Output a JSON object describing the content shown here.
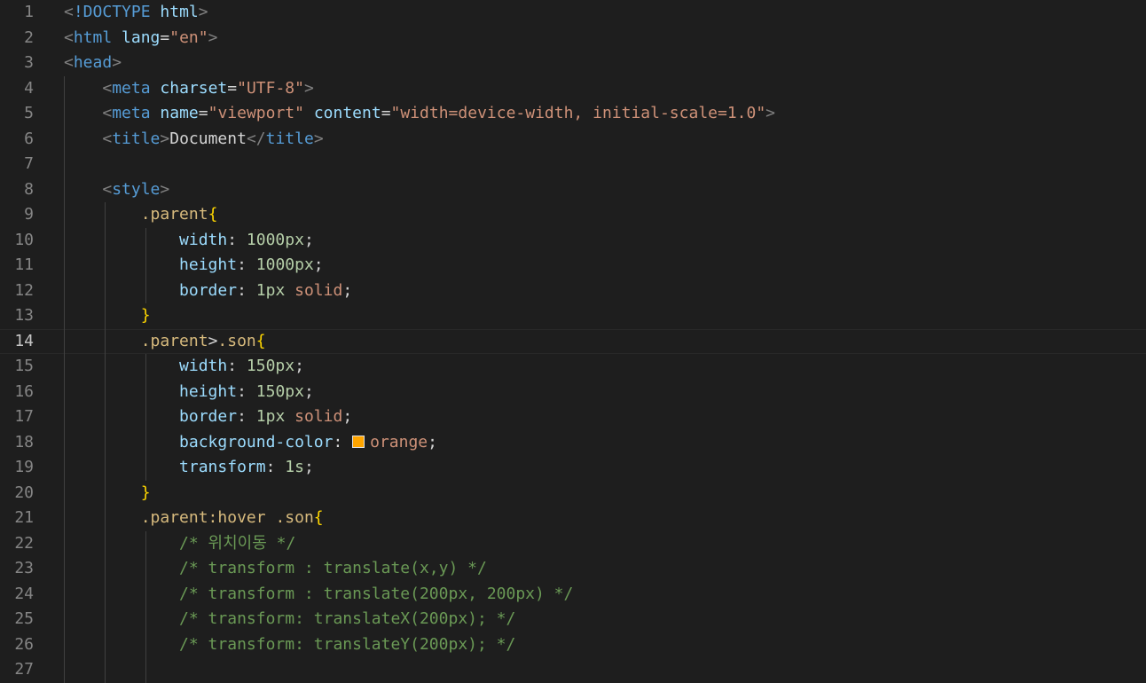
{
  "editor": {
    "current_line": 14,
    "swatch_color": "#ffa500",
    "lines": [
      {
        "n": "1",
        "indent": 0,
        "tokens": [
          [
            "&lt;",
            "p"
          ]
        ]
      },
      {
        "n": "2",
        "indent": 0,
        "tokens": []
      },
      {
        "n": "3",
        "indent": 0,
        "tokens": []
      }
    ]
  },
  "lines": [
    {
      "n": "1",
      "tokens": [
        [
          "<",
          "punct"
        ],
        [
          "!DOCTYPE",
          "tag"
        ],
        [
          " ",
          "text"
        ],
        [
          "html",
          "attr"
        ],
        [
          ">",
          "punct"
        ]
      ]
    },
    {
      "n": "2",
      "tokens": [
        [
          "<",
          "punct"
        ],
        [
          "html",
          "tag"
        ],
        [
          " ",
          "text"
        ],
        [
          "lang",
          "attr"
        ],
        [
          "=",
          "text"
        ],
        [
          "\"en\"",
          "str"
        ],
        [
          ">",
          "punct"
        ]
      ]
    },
    {
      "n": "3",
      "tokens": [
        [
          "<",
          "punct"
        ],
        [
          "head",
          "tag"
        ],
        [
          ">",
          "punct"
        ]
      ]
    },
    {
      "n": "4",
      "tokens": [
        [
          "    ",
          "text"
        ],
        [
          "<",
          "punct"
        ],
        [
          "meta",
          "tag"
        ],
        [
          " ",
          "text"
        ],
        [
          "charset",
          "attr"
        ],
        [
          "=",
          "text"
        ],
        [
          "\"UTF-8\"",
          "str"
        ],
        [
          ">",
          "punct"
        ]
      ]
    },
    {
      "n": "5",
      "tokens": [
        [
          "    ",
          "text"
        ],
        [
          "<",
          "punct"
        ],
        [
          "meta",
          "tag"
        ],
        [
          " ",
          "text"
        ],
        [
          "name",
          "attr"
        ],
        [
          "=",
          "text"
        ],
        [
          "\"viewport\"",
          "str"
        ],
        [
          " ",
          "text"
        ],
        [
          "content",
          "attr"
        ],
        [
          "=",
          "text"
        ],
        [
          "\"width=device-width, initial-scale=1.0\"",
          "str"
        ],
        [
          ">",
          "punct"
        ]
      ]
    },
    {
      "n": "6",
      "tokens": [
        [
          "    ",
          "text"
        ],
        [
          "<",
          "punct"
        ],
        [
          "title",
          "tag"
        ],
        [
          ">",
          "punct"
        ],
        [
          "Document",
          "text"
        ],
        [
          "</",
          "punct"
        ],
        [
          "title",
          "tag"
        ],
        [
          ">",
          "punct"
        ]
      ]
    },
    {
      "n": "7",
      "tokens": []
    },
    {
      "n": "8",
      "tokens": [
        [
          "    ",
          "text"
        ],
        [
          "<",
          "punct"
        ],
        [
          "style",
          "tag"
        ],
        [
          ">",
          "punct"
        ]
      ]
    },
    {
      "n": "9",
      "tokens": [
        [
          "        ",
          "text"
        ],
        [
          ".parent",
          "sel"
        ],
        [
          "{",
          "brace"
        ]
      ]
    },
    {
      "n": "10",
      "tokens": [
        [
          "            ",
          "text"
        ],
        [
          "width",
          "prop"
        ],
        [
          ": ",
          "text"
        ],
        [
          "1000px",
          "num"
        ],
        [
          ";",
          "text"
        ]
      ]
    },
    {
      "n": "11",
      "tokens": [
        [
          "            ",
          "text"
        ],
        [
          "height",
          "prop"
        ],
        [
          ": ",
          "text"
        ],
        [
          "1000px",
          "num"
        ],
        [
          ";",
          "text"
        ]
      ]
    },
    {
      "n": "12",
      "tokens": [
        [
          "            ",
          "text"
        ],
        [
          "border",
          "prop"
        ],
        [
          ": ",
          "text"
        ],
        [
          "1px",
          "num"
        ],
        [
          " ",
          "text"
        ],
        [
          "solid",
          "kw"
        ],
        [
          ";",
          "text"
        ]
      ]
    },
    {
      "n": "13",
      "tokens": [
        [
          "        ",
          "text"
        ],
        [
          "}",
          "brace"
        ]
      ]
    },
    {
      "n": "14",
      "tokens": [
        [
          "        ",
          "text"
        ],
        [
          ".parent",
          "sel"
        ],
        [
          ">",
          "text"
        ],
        [
          ".son",
          "sel"
        ],
        [
          "{",
          "brace"
        ]
      ]
    },
    {
      "n": "15",
      "tokens": [
        [
          "            ",
          "text"
        ],
        [
          "width",
          "prop"
        ],
        [
          ": ",
          "text"
        ],
        [
          "150px",
          "num"
        ],
        [
          ";",
          "text"
        ]
      ]
    },
    {
      "n": "16",
      "tokens": [
        [
          "            ",
          "text"
        ],
        [
          "height",
          "prop"
        ],
        [
          ": ",
          "text"
        ],
        [
          "150px",
          "num"
        ],
        [
          ";",
          "text"
        ]
      ]
    },
    {
      "n": "17",
      "tokens": [
        [
          "            ",
          "text"
        ],
        [
          "border",
          "prop"
        ],
        [
          ": ",
          "text"
        ],
        [
          "1px",
          "num"
        ],
        [
          " ",
          "text"
        ],
        [
          "solid",
          "kw"
        ],
        [
          ";",
          "text"
        ]
      ]
    },
    {
      "n": "18",
      "tokens": [
        [
          "            ",
          "text"
        ],
        [
          "background-color",
          "prop"
        ],
        [
          ": ",
          "text"
        ],
        [
          "",
          "swatch"
        ],
        [
          "orange",
          "kw"
        ],
        [
          ";",
          "text"
        ]
      ]
    },
    {
      "n": "19",
      "tokens": [
        [
          "            ",
          "text"
        ],
        [
          "transform",
          "prop"
        ],
        [
          ": ",
          "text"
        ],
        [
          "1s",
          "num"
        ],
        [
          ";",
          "text"
        ]
      ]
    },
    {
      "n": "20",
      "tokens": [
        [
          "        ",
          "text"
        ],
        [
          "}",
          "brace"
        ]
      ]
    },
    {
      "n": "21",
      "tokens": [
        [
          "        ",
          "text"
        ],
        [
          ".parent:hover",
          "sel"
        ],
        [
          " ",
          "text"
        ],
        [
          ".son",
          "sel"
        ],
        [
          "{",
          "brace"
        ]
      ]
    },
    {
      "n": "22",
      "tokens": [
        [
          "            ",
          "text"
        ],
        [
          "/* 위치이동 */",
          "comment"
        ]
      ]
    },
    {
      "n": "23",
      "tokens": [
        [
          "            ",
          "text"
        ],
        [
          "/* transform : translate(x,y) */",
          "comment"
        ]
      ]
    },
    {
      "n": "24",
      "tokens": [
        [
          "            ",
          "text"
        ],
        [
          "/* transform : translate(200px, 200px) */",
          "comment"
        ]
      ]
    },
    {
      "n": "25",
      "tokens": [
        [
          "            ",
          "text"
        ],
        [
          "/* transform: translateX(200px); */",
          "comment"
        ]
      ]
    },
    {
      "n": "26",
      "tokens": [
        [
          "            ",
          "text"
        ],
        [
          "/* transform: translateY(200px); */",
          "comment"
        ]
      ]
    },
    {
      "n": "27",
      "tokens": []
    }
  ]
}
